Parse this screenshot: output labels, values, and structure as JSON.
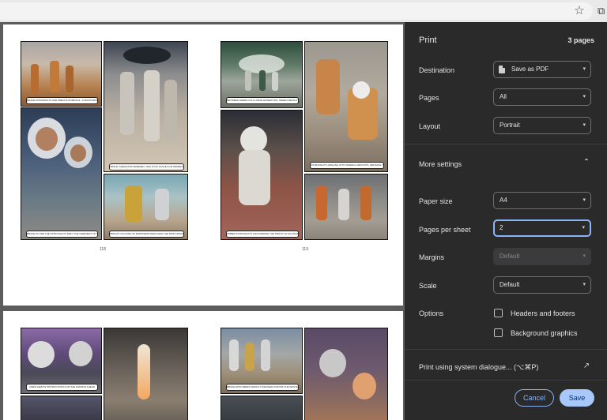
{
  "toolbar": {
    "bookmark_icon": "star-icon",
    "extensions_icon": "puzzle-icon"
  },
  "preview": {
    "sheet1": {
      "left_page": {
        "number": "118",
        "captions": [
          "BRAVE ASTRONAUTS AND PRECIOUS METALS - A MOON MISSION WORTH TODAY",
          "WHILE THEIR EYES WIDENED, THIS IS NO PLACE FOR ORDERS",
          "BRAVE AS ONE THE ASTRONAUTS DEFY THE STERNEST OF CHAOS",
          "BRIGHT COLOURS OF EMPTINESS REACHING THE FIRST SPACE COOLS"
        ]
      },
      "right_page": {
        "number": "119",
        "captions": [
          "BETWEEN GREEN ON A LUNAR EXPEDITION, GREEN METALS LEADING TOWARD OUTER SPACE",
          "ASTRONAUTS DRILLING INTO MINERAL DEPOSITS, DEFINING THE FUTURE OF DEEP SPACE",
          "AMBER ASTRONAUTS UNCOVERING THE PROOF OF AN ANCIENT STRUCTURE"
        ]
      }
    },
    "sheet2": {
      "left_page": {
        "captions": [
          "CREW AWAITS INSTRUCTIONS FOR THE MISSION AHEAD"
        ]
      },
      "right_page": {
        "captions": [
          "BRAVE EXPLORERS MARCH TOGETHER ACROSS THE WASTELAND"
        ]
      }
    }
  },
  "dialog": {
    "title": "Print",
    "page_count": "3 pages",
    "destination": {
      "label": "Destination",
      "value": "Save as PDF"
    },
    "pages": {
      "label": "Pages",
      "value": "All"
    },
    "layout": {
      "label": "Layout",
      "value": "Portrait"
    },
    "more_settings": "More settings",
    "paper_size": {
      "label": "Paper size",
      "value": "A4"
    },
    "pages_per_sheet": {
      "label": "Pages per sheet",
      "value": "2"
    },
    "margins": {
      "label": "Margins",
      "value": "Default"
    },
    "scale": {
      "label": "Scale",
      "value": "Default"
    },
    "options": {
      "label": "Options",
      "headers_footers": "Headers and footers",
      "background_graphics": "Background graphics"
    },
    "system_dialog": "Print using system dialogue... (⌥⌘P)",
    "cancel": "Cancel",
    "save": "Save"
  },
  "colors": {
    "dialog_bg": "#2a2a2b",
    "accent": "#8ab4f8",
    "save_bg": "#a8c7fa"
  }
}
